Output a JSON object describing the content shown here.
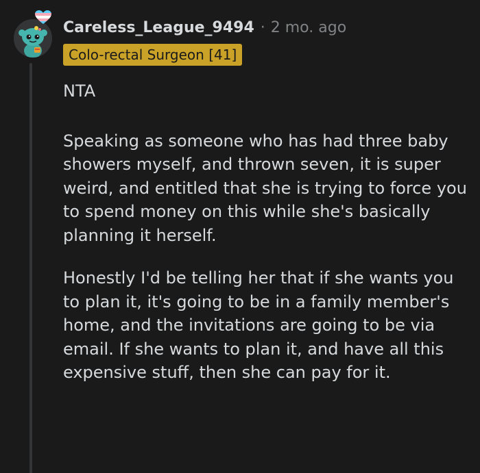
{
  "comment": {
    "username": "Careless_League_9494",
    "separator": "·",
    "timestamp": "2 mo. ago",
    "flair": "Colo-rectal Surgeon [41]",
    "paragraphs": [
      "NTA",
      "Speaking as someone who has had three baby showers myself, and thrown seven, it is super weird, and entitled that she is trying to force you to spend money on this while she's basically planning it herself.",
      "Honestly I'd be telling her that if she wants you to plan it, it's going to be in a family member's home, and the invitations are going to be via email. If she wants to plan it, and have all this expensive stuff, then she can pay for it."
    ]
  },
  "colors": {
    "background": "#1a1a1b",
    "text": "#d7dadc",
    "muted": "#818384",
    "flair_bg": "#c9a227",
    "thread_line": "#343536"
  },
  "icons": {
    "avatar": "snoo-avatar-icon",
    "badge": "trans-heart-flag-icon"
  }
}
